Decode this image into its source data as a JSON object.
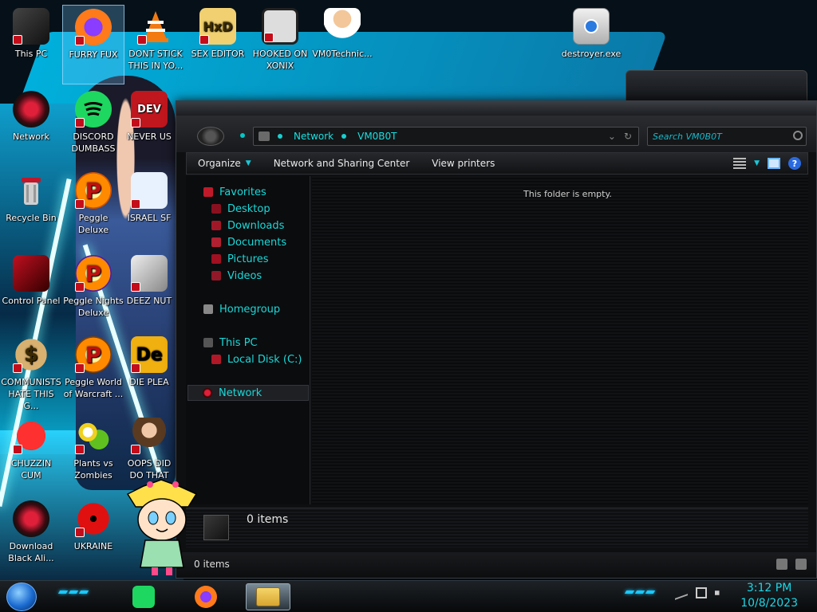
{
  "desktop": {
    "icons": [
      {
        "label": "This PC"
      },
      {
        "label": "FURRY FUX"
      },
      {
        "label": "DONT STICK THIS IN YO..."
      },
      {
        "label": "SEX EDITOR"
      },
      {
        "label": "HOOKED ON XONIX"
      },
      {
        "label": "VM0Technic..."
      },
      {
        "label": "destroyer.exe"
      },
      {
        "label": "Network"
      },
      {
        "label": "DISCORD DUMBASS"
      },
      {
        "label": "NEVER US"
      },
      {
        "label": "Recycle Bin"
      },
      {
        "label": "Peggle Deluxe"
      },
      {
        "label": "ISRAEL SF"
      },
      {
        "label": "Control Panel"
      },
      {
        "label": "Peggle Nights Deluxe"
      },
      {
        "label": "DEEZ NUT"
      },
      {
        "label": "COMMUNISTS HATE THIS G..."
      },
      {
        "label": "Peggle World of Warcraft ..."
      },
      {
        "label": "DIE PLEA"
      },
      {
        "label": "CHUZZIN CUM"
      },
      {
        "label": "Plants vs Zombies"
      },
      {
        "label": "OOPS DID DO THAT"
      },
      {
        "label": "Download Black Ali..."
      },
      {
        "label": "UKRAINE"
      }
    ]
  },
  "explorer": {
    "address": {
      "crumb_root": "Network",
      "crumb_current": "VM0B0T",
      "dropdown_glyph": "⌄",
      "refresh_glyph": "↻"
    },
    "search": {
      "placeholder": "Search VM0B0T"
    },
    "toolbar": {
      "organize": "Organize",
      "organize_arrow": "▼",
      "network_sharing": "Network and Sharing Center",
      "view_printers": "View printers",
      "view_arrow": "▼",
      "help": "?"
    },
    "nav": {
      "favorites": "Favorites",
      "desktop": "Desktop",
      "downloads": "Downloads",
      "documents": "Documents",
      "pictures": "Pictures",
      "videos": "Videos",
      "homegroup": "Homegroup",
      "this_pc": "This PC",
      "local_disk": "Local Disk (C:)",
      "network": "Network"
    },
    "content": {
      "empty_message": "This folder is empty."
    },
    "details": {
      "item_count": "0 items"
    },
    "status": {
      "item_count": "0 items"
    }
  },
  "taskbar": {
    "clock_time": "3:12 PM",
    "clock_date": "10/8/2023"
  },
  "colors": {
    "accent": "#1ad8d8",
    "window_bg": "#0d0f11",
    "wallpaper_cyan": "#00b8e6"
  }
}
